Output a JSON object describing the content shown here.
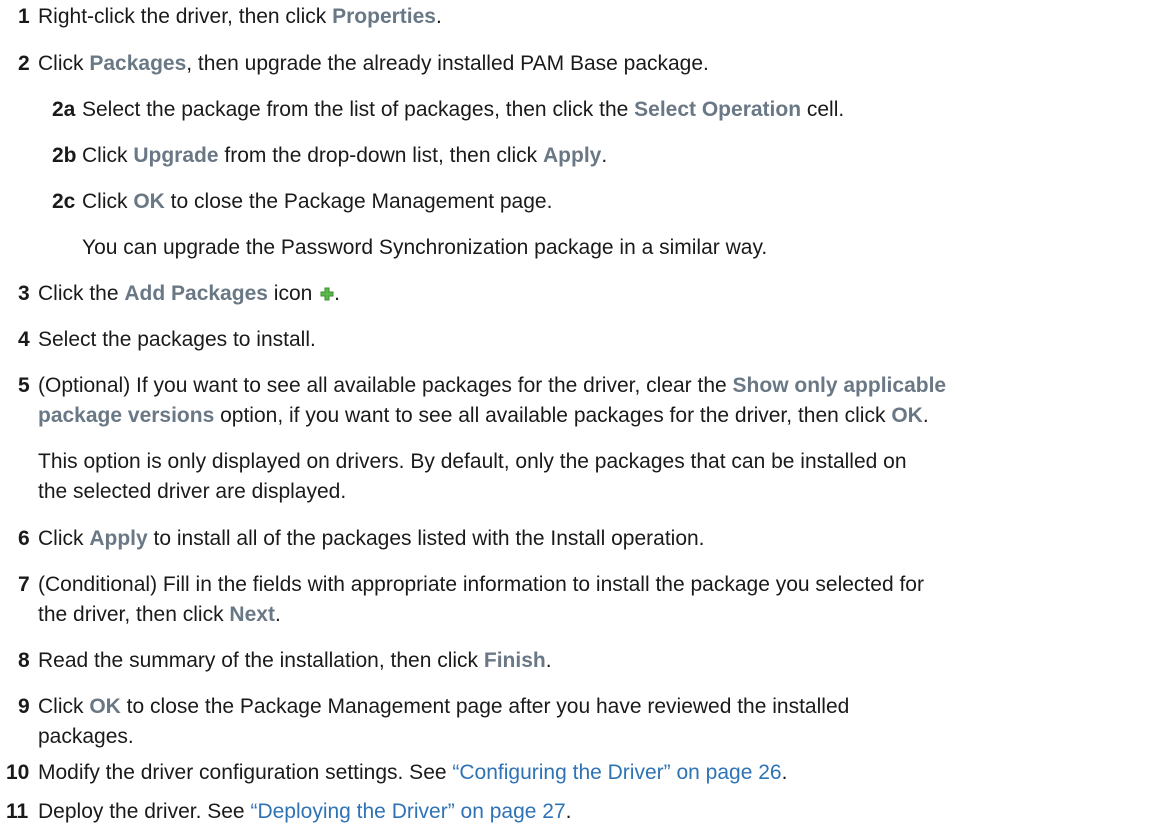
{
  "steps": {
    "s1": {
      "num": "1",
      "t1": "Right-click the driver, then click ",
      "b1": "Properties",
      "t2": "."
    },
    "s2": {
      "num": "2",
      "t1": "Click ",
      "b1": "Packages",
      "t2": ", then upgrade the already installed PAM Base package."
    },
    "s2a": {
      "num": "2a",
      "t1": "Select the package from the list of packages, then click the ",
      "b1": "Select Operation",
      "t2": " cell."
    },
    "s2b": {
      "num": "2b",
      "t1": "Click ",
      "b1": "Upgrade",
      "t2": " from the drop-down list, then click ",
      "b2": "Apply",
      "t3": "."
    },
    "s2c": {
      "num": "2c",
      "t1": "Click ",
      "b1": "OK",
      "t2": " to close the Package Management page."
    },
    "s2note": "You can upgrade the Password Synchronization package in a similar way.",
    "s3": {
      "num": "3",
      "t1": "Click the ",
      "b1": "Add Packages",
      "t2": " icon ",
      "icon": "plus-icon",
      "t3": "."
    },
    "s4": {
      "num": "4",
      "t1": "Select the packages to install."
    },
    "s5": {
      "num": "5",
      "l1_t1": "(Optional) If you want to see all available packages for the driver, clear the ",
      "l1_b1": "Show only applicable",
      "l2_b1": "package versions",
      "l2_t1": " option, if you want to see all available packages for the driver, then click ",
      "l2_b2": "OK",
      "l2_t2": "."
    },
    "s5note": {
      "l1": "This option is only displayed on drivers. By default, only the packages that can be installed on",
      "l2": "the selected driver are displayed."
    },
    "s6": {
      "num": "6",
      "t1": "Click ",
      "b1": "Apply",
      "t2": " to install all of the packages listed with the Install operation."
    },
    "s7": {
      "num": "7",
      "l1": "(Conditional) Fill in the fields with appropriate information to install the package you selected for",
      "l2_t1": "the driver, then click ",
      "l2_b1": "Next",
      "l2_t2": "."
    },
    "s8": {
      "num": "8",
      "t1": "Read the summary of the installation, then click ",
      "b1": "Finish",
      "t2": "."
    },
    "s9": {
      "num": "9",
      "t1": "Click ",
      "b1": "OK",
      "l1_t2": " to close the Package Management page after you have reviewed the installed",
      "l2": "packages."
    },
    "s10": {
      "num": "10",
      "t1": "Modify the driver configuration settings. See ",
      "link": "“Configuring the Driver” on page 26",
      "t2": "."
    },
    "s11": {
      "num": "11",
      "t1": "Deploy the driver. See ",
      "link": "“Deploying the Driver” on page 27",
      "t2": "."
    }
  },
  "colors": {
    "ui_text": "#6a7886",
    "link": "#2f73b5",
    "icon_green": "#4caf3c"
  }
}
